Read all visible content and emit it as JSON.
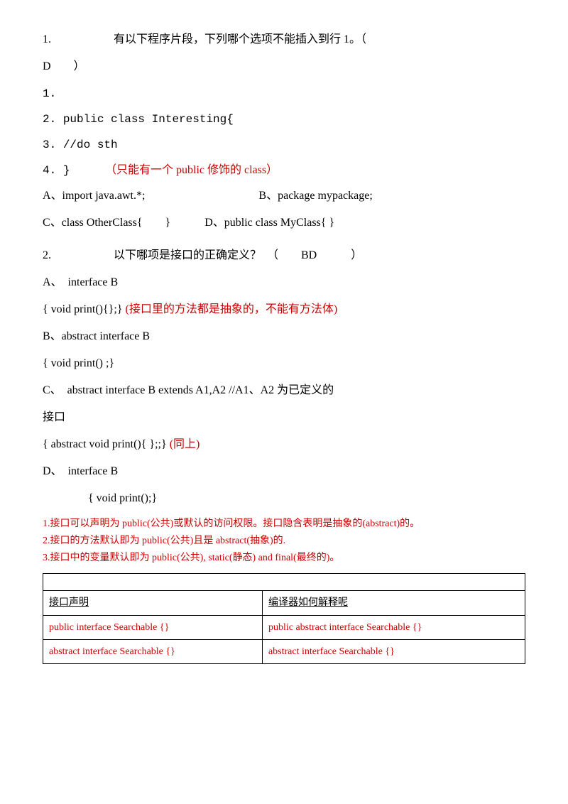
{
  "questions": [
    {
      "number": "1.",
      "text_before": "有以下程序片段，下列哪个选项不能插入到行 1。（",
      "answer": "D　　）",
      "lines": [
        {
          "num": "1.",
          "content": ""
        },
        {
          "num": "2.",
          "content": "public   class   Interesting{"
        },
        {
          "num": "3.",
          "content": "//do sth"
        },
        {
          "num": "4.",
          "content": "}"
        }
      ],
      "line4_note": "（只能有一个 public 修饰的 class）",
      "options": [
        {
          "label": "A、",
          "text": "import java.awt.*;",
          "spacer": "　　　　　　　",
          "label2": "B、",
          "text2": "package mypackage;"
        },
        {
          "label": "C、",
          "text": "class OtherClass{　　}　　",
          "label2": "D、",
          "text2": "public class MyClass{ }"
        }
      ]
    },
    {
      "number": "2.",
      "text_before": "以下哪项是接口的正确定义？　（　　BD　　　）",
      "options_detail": [
        {
          "label": "A、",
          "line1": "interface   B",
          "line2": "{ void print(){};} ",
          "line2_note": "(接口里的方法都是抽象的，不能有方法体)"
        },
        {
          "label": "B、",
          "line1": "abstract   interface   B",
          "line2": "{ void print() ;}"
        },
        {
          "label": "C、",
          "line1": "abstract   interface   B   extends   A1,A2   //A1、A2 为已定义的接口",
          "line2": "{ abstract   void   print(){   };;} ",
          "line2_note": "(同上)"
        },
        {
          "label": "D、",
          "line1": "interface   B",
          "line2": "　　　{ void   print();}"
        }
      ]
    }
  ],
  "notes": [
    "1.接口可以声明为 public(公共)或默认的访问权限。接口隐含表明是抽象的(abstract)的。",
    "2.接口的方法默认即为 public(公共)且是 abstract(抽象)的.",
    "3.接口中的变量默认即为 public(公共), static(静态) and final(最终的)。"
  ],
  "table": {
    "empty_row": "",
    "header": [
      "接口声明",
      "编译器如何解释呢"
    ],
    "rows": [
      [
        "public interface Searchable {}",
        "public abstract interface Searchable {}"
      ],
      [
        "abstract interface Searchable {}",
        "abstract interface Searchable {}"
      ]
    ]
  }
}
